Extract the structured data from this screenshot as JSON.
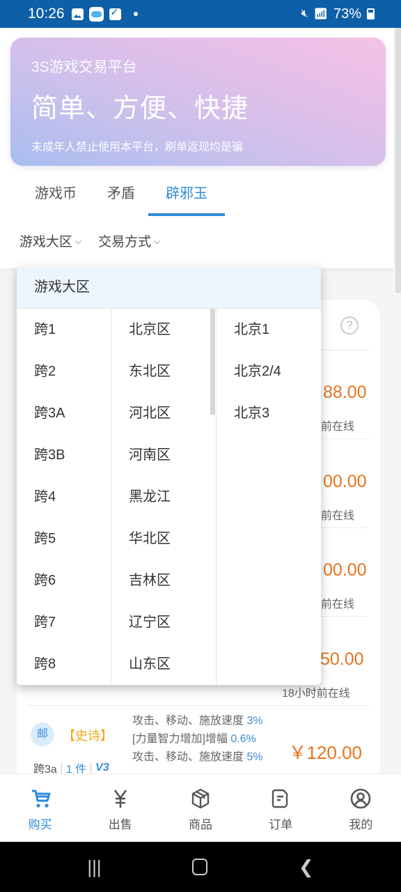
{
  "status_bar": {
    "time": "10:26",
    "battery": "73%",
    "icons": [
      "gallery-icon",
      "weather-icon",
      "checkbox-icon",
      "notification-dot",
      "mute-icon",
      "wifi-icon",
      "signal-icon",
      "battery-icon"
    ]
  },
  "banner": {
    "subtitle": "3S游戏交易平台",
    "title": "简单、方便、快捷",
    "note": "未成年人禁止使用本平台，刷单返现均是骗"
  },
  "tabs": [
    {
      "label": "游戏币",
      "active": false
    },
    {
      "label": "矛盾",
      "active": false
    },
    {
      "label": "辟邪玉",
      "active": true
    }
  ],
  "filters": [
    {
      "label": "游戏大区",
      "icon": "chevron-down-icon"
    },
    {
      "label": "交易方式",
      "icon": "chevron-down-icon"
    }
  ],
  "dropdown": {
    "title": "游戏大区",
    "column1": [
      "跨1",
      "跨2",
      "跨3A",
      "跨3B",
      "跨4",
      "跨5",
      "跨6",
      "跨7",
      "跨8"
    ],
    "column2": [
      "北京区",
      "东北区",
      "河北区",
      "河南区",
      "黑龙江",
      "华北区",
      "吉林区",
      "辽宁区",
      "山东区"
    ],
    "column3": [
      "北京1",
      "北京2/4",
      "北京3"
    ]
  },
  "listings": {
    "partial_prices": [
      "88.00",
      "00.00",
      "00.00",
      "50.00"
    ],
    "partial_online": [
      "前在线",
      "前在线",
      "前在线",
      "18小时前在线"
    ],
    "item": {
      "badge": "邮",
      "rarity": "【史诗】",
      "server": "跨3a",
      "count": "1 件",
      "vip": "V3",
      "attributes": [
        {
          "text": "攻击、移动、施放速度",
          "value": "3%"
        },
        {
          "text": "[力量智力增加]增幅",
          "value": "0.6%"
        },
        {
          "text": "攻击、移动、施放速度",
          "value": "5%"
        }
      ],
      "price": "￥120.00"
    }
  },
  "bottom_nav": [
    {
      "label": "购买",
      "icon": "cart-icon",
      "active": true
    },
    {
      "label": "出售",
      "icon": "yen-icon",
      "active": false
    },
    {
      "label": "商品",
      "icon": "box-icon",
      "active": false
    },
    {
      "label": "订单",
      "icon": "order-icon",
      "active": false
    },
    {
      "label": "我的",
      "icon": "profile-icon",
      "active": false
    }
  ],
  "colors": {
    "accent": "#2f8ad8",
    "price": "#e8731e",
    "rarity": "#f0a81a",
    "status_bar": "#0d5fa8"
  }
}
